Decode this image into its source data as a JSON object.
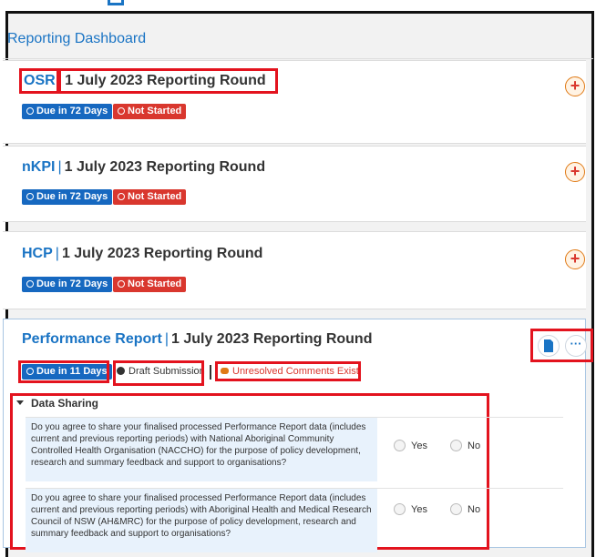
{
  "dashboard": {
    "title": "Reporting Dashboard"
  },
  "panels": [
    {
      "acronym": "OSR",
      "round": "1 July 2023 Reporting Round",
      "due": "Due in 72 Days",
      "status": "Not Started"
    },
    {
      "acronym": "nKPI",
      "round": "1 July 2023 Reporting Round",
      "due": "Due in 72 Days",
      "status": "Not Started"
    },
    {
      "acronym": "HCP",
      "round": "1 July 2023 Reporting Round",
      "due": "Due in 72 Days",
      "status": "Not Started"
    }
  ],
  "performance": {
    "acronym": "Performance Report",
    "round": "1 July 2023 Reporting Round",
    "due": "Due in 11 Days",
    "status": "Draft Submission",
    "comments": "Unresolved Comments Exist",
    "section": "Data Sharing",
    "questions": [
      {
        "text": "Do you agree to share your finalised processed Performance Report data (includes current and previous reporting periods) with National Aboriginal Community Controlled Health Organisation (NACCHO) for the purpose of policy development, research and summary feedback and support to organisations?",
        "yes": "Yes",
        "no": "No"
      },
      {
        "text": "Do you agree to share your finalised processed Performance Report data (includes current and previous reporting periods) with Aboriginal Health and Medical Research Council of NSW (AH&MRC) for the purpose of policy development, research and summary feedback and support to organisations?",
        "yes": "Yes",
        "no": "No"
      }
    ]
  },
  "colors": {
    "accent": "#1a74c4",
    "due": "#1668c0",
    "not_started": "#d9372e",
    "highlight": "#e3131e",
    "add": "#e07a16"
  },
  "icons": {
    "add": "plus-icon",
    "clock": "clock-icon",
    "arrow": "arrow-circle-icon",
    "document": "document-icon",
    "more": "ellipsis-icon",
    "comment": "comment-icon",
    "collapse": "caret-down-icon"
  }
}
